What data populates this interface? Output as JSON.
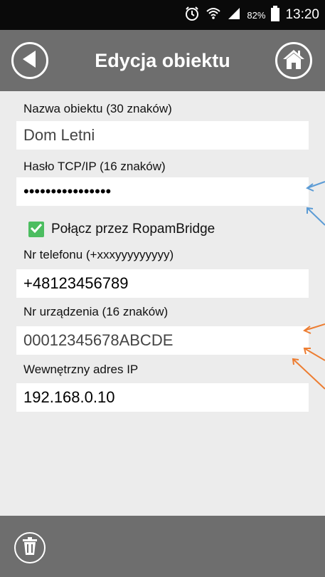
{
  "status_bar": {
    "battery": "82%",
    "time": "13:20",
    "icons": [
      "alarm-icon",
      "wifi-icon",
      "signal-icon",
      "battery-icon"
    ]
  },
  "header": {
    "title": "Edycja obiektu",
    "back_icon": "back-arrow-icon",
    "home_icon": "home-icon"
  },
  "form": {
    "name_label": "Nazwa obiektu (30 znaków)",
    "name_value": "Dom Letni",
    "password_label": "Hasło TCP/IP (16 znaków)",
    "password_value": "••••••••••••••••",
    "bridge_label": "Połącz przez RopamBridge",
    "bridge_checked": true,
    "phone_label": "Nr telefonu (+xxxyyyyyyyyy)",
    "phone_value": "+48123456789",
    "device_label": "Nr urządzenia (16 znaków)",
    "device_value": "00012345678ABCDE",
    "ip_label": "Wewnętrzny adres IP",
    "ip_value": "192.168.0.10"
  },
  "footer": {
    "delete_icon": "trash-icon"
  },
  "colors": {
    "status_bar": "#0a0a0a",
    "app_bar": "#6e6e6e",
    "background": "#ececec",
    "checkbox": "#4cbd60",
    "arrow_blue": "#5b9bd5",
    "arrow_orange": "#ed7d31"
  }
}
